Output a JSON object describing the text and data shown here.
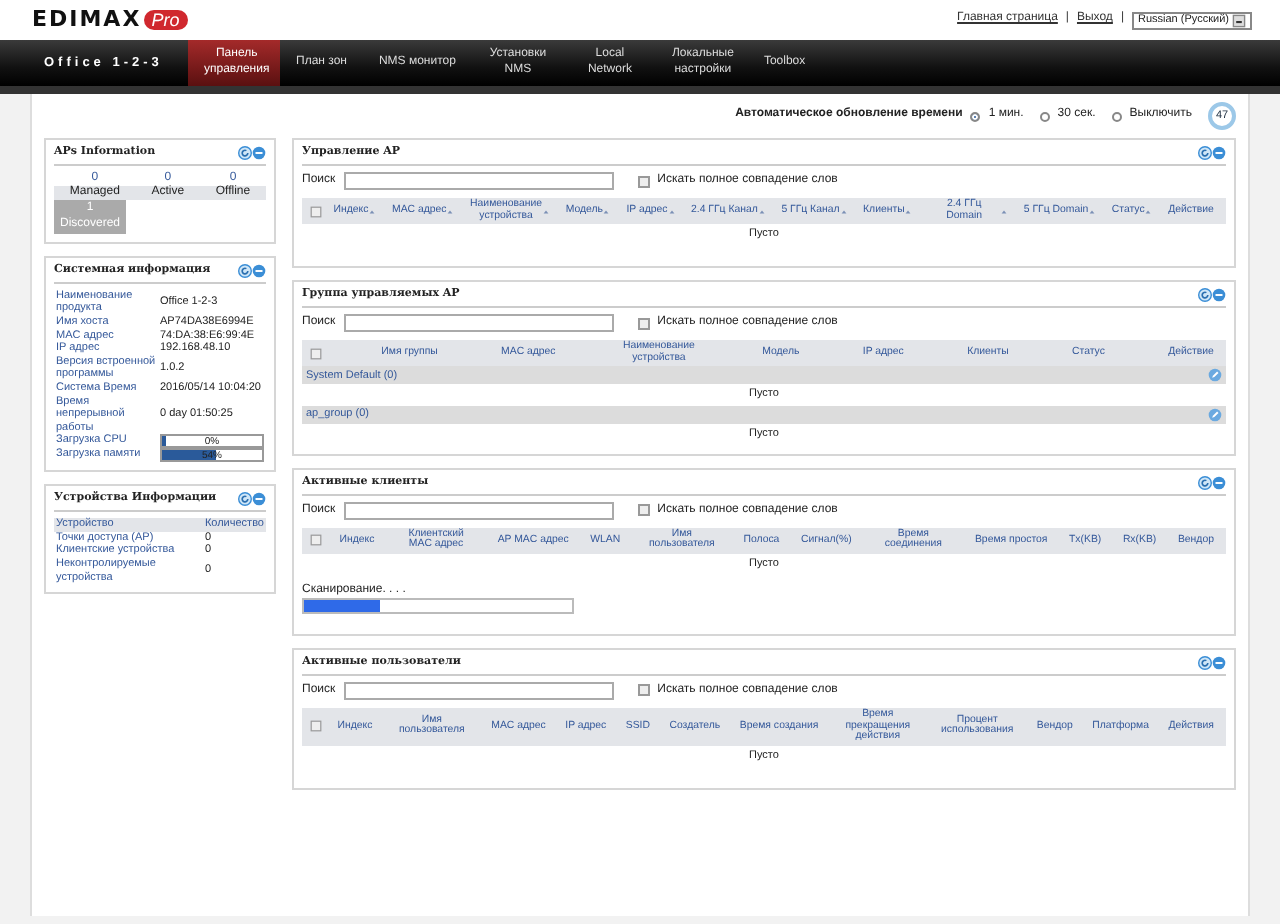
{
  "logo": {
    "brand": "EDIMAX",
    "badge": "Pro"
  },
  "top_links": [
    {
      "kind": "link",
      "text": "Главная страница"
    },
    {
      "kind": "separator",
      "text": "|"
    },
    {
      "kind": "link",
      "text": "Выход"
    },
    {
      "kind": "separator",
      "text": "|"
    }
  ],
  "language": {
    "value": "Russian (Русский)"
  },
  "site_name": "Office 1-2-3",
  "nav": [
    {
      "label": "Панель управления",
      "selected": true
    },
    {
      "label": "План зон",
      "selected": false
    },
    {
      "label": "NMS монитор",
      "selected": false
    },
    {
      "label": "Установки NMS",
      "selected": false
    },
    {
      "label": "Local Network",
      "selected": false
    },
    {
      "label": "Локальные настройки",
      "selected": false
    },
    {
      "label": "Toolbox",
      "selected": false
    }
  ],
  "auto_refresh": {
    "label": "Автоматическое обновление времени",
    "options": [
      {
        "label": "1 мин.",
        "selected": true
      },
      {
        "label": "30 сек.",
        "selected": false
      },
      {
        "label": "Выключить",
        "selected": false
      }
    ],
    "countdown": "47"
  },
  "aps_info": {
    "title": "APs Information",
    "stats": [
      {
        "value": "0",
        "label": "Managed"
      },
      {
        "value": "0",
        "label": "Active"
      },
      {
        "value": "0",
        "label": "Offline"
      }
    ],
    "discovered": {
      "value": "1",
      "label": "Discovered"
    }
  },
  "system_info": {
    "title": "Системная информация",
    "rows": [
      {
        "label": "Наименование продукта",
        "value": "Office 1-2-3"
      },
      {
        "label": "Имя хоста",
        "value": "AP74DA38E6994E"
      },
      {
        "label": "MAC адрес",
        "value": "74:DA:38:E6:99:4E"
      },
      {
        "label": "IP адрес",
        "value": "192.168.48.10"
      },
      {
        "label": "Версия встроенной программы",
        "value": "1.0.2"
      },
      {
        "label": "Система Время",
        "value": "2016/05/14 10:04:20"
      },
      {
        "label": "Время непрерывной работы",
        "value": "0 day 01:50:25"
      }
    ],
    "meters": [
      {
        "label": "Загрузка CPU",
        "level": 0.04,
        "reading": "0%"
      },
      {
        "label": "Загрузка памяти",
        "level": 0.54,
        "reading": "54%"
      }
    ]
  },
  "device_info": {
    "title": "Устройства Информации",
    "columns": [
      "Устройство",
      "Количество"
    ],
    "rows": [
      [
        "Точки доступа (AP)",
        "0"
      ],
      [
        "Клиентские устройства",
        "0"
      ],
      [
        "Неконтролируемые устройства",
        "0"
      ]
    ]
  },
  "panels": [
    {
      "kind": "table",
      "title": "Управление AP",
      "search_label": "Поиск",
      "exact_label": "Искать полное совпадение слов",
      "exact_checked": false,
      "select_all_checked": false,
      "columns": [
        {
          "label": "Индекс",
          "sortable": true
        },
        {
          "label": "MAC адрес",
          "sortable": true
        },
        {
          "label": "Наименование устройства",
          "sortable": true
        },
        {
          "label": "Модель",
          "sortable": true
        },
        {
          "label": "IP адрес",
          "sortable": true
        },
        {
          "label": "2.4 ГГц Канал",
          "sortable": true
        },
        {
          "label": "5 ГГц Канал",
          "sortable": true
        },
        {
          "label": "Клиенты",
          "sortable": true
        },
        {
          "label": "2.4 ГГц Domain",
          "sortable": true
        },
        {
          "label": "5 ГГц Domain",
          "sortable": true
        },
        {
          "label": "Статус",
          "sortable": true
        },
        {
          "label": "Действие",
          "sortable": false
        }
      ],
      "empty": "Пусто"
    },
    {
      "kind": "groups",
      "title": "Группа управляемых AP",
      "search_label": "Поиск",
      "exact_label": "Искать полное совпадение слов",
      "exact_checked": false,
      "select_all_checked": false,
      "columns": [
        {
          "label": "Имя группы",
          "sortable": false
        },
        {
          "label": "MAC адрес",
          "sortable": false
        },
        {
          "label": "Наименование устройства",
          "sortable": false
        },
        {
          "label": "Модель",
          "sortable": false
        },
        {
          "label": "IP адрес",
          "sortable": false
        },
        {
          "label": "Клиенты",
          "sortable": false
        },
        {
          "label": "Статус",
          "sortable": false
        },
        {
          "label": "Действие",
          "sortable": false
        }
      ],
      "groups": [
        {
          "name": "System Default (0)",
          "empty": "Пусто"
        },
        {
          "name": "ap_group (0)",
          "empty": "Пусто"
        }
      ]
    },
    {
      "kind": "scan",
      "title": "Активные клиенты",
      "search_label": "Поиск",
      "exact_label": "Искать полное совпадение слов",
      "exact_checked": false,
      "select_all_checked": false,
      "columns": [
        {
          "label": "Индекс",
          "sortable": false
        },
        {
          "label": "Клиентский MAC адрес",
          "sortable": false
        },
        {
          "label": "AP MAC адрес",
          "sortable": false
        },
        {
          "label": "WLAN",
          "sortable": false
        },
        {
          "label": "Имя пользователя",
          "sortable": false
        },
        {
          "label": "Полоса",
          "sortable": false
        },
        {
          "label": "Сигнал(%)",
          "sortable": false
        },
        {
          "label": "Время соединения",
          "sortable": false
        },
        {
          "label": "Время простоя",
          "sortable": false
        },
        {
          "label": "Tx(KB)",
          "sortable": false
        },
        {
          "label": "Rx(KB)",
          "sortable": false
        },
        {
          "label": "Вендор",
          "sortable": false
        }
      ],
      "empty": "Пусто",
      "scan": {
        "label": "Сканирование. . . .",
        "level": 0.28
      }
    },
    {
      "kind": "table",
      "title": "Активные пользователи",
      "search_label": "Поиск",
      "exact_label": "Искать полное совпадение слов",
      "exact_checked": false,
      "select_all_checked": false,
      "columns": [
        {
          "label": "Индекс",
          "sortable": false
        },
        {
          "label": "Имя пользователя",
          "sortable": false
        },
        {
          "label": "MAC адрес",
          "sortable": false
        },
        {
          "label": "IP адрес",
          "sortable": false
        },
        {
          "label": "SSID",
          "sortable": false
        },
        {
          "label": "Создатель",
          "sortable": false
        },
        {
          "label": "Время создания",
          "sortable": false
        },
        {
          "label": "Время прекращения действия",
          "sortable": false
        },
        {
          "label": "Процент использования",
          "sortable": false
        },
        {
          "label": "Вендор",
          "sortable": false
        },
        {
          "label": "Платформа",
          "sortable": false
        },
        {
          "label": "Действия",
          "sortable": false
        }
      ],
      "empty": "Пусто"
    }
  ]
}
